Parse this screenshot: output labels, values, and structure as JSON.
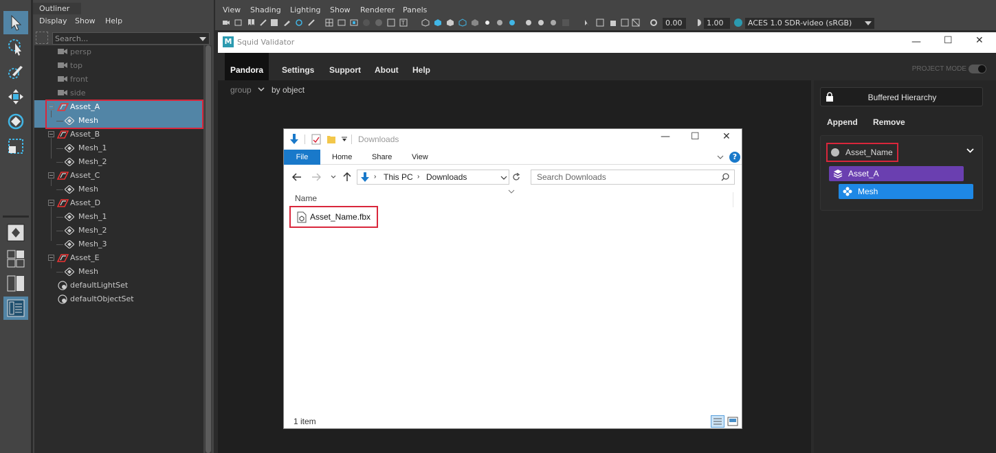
{
  "outliner": {
    "tab": "Outliner",
    "menu": [
      "Display",
      "Show",
      "Help"
    ],
    "search_placeholder": "Search...",
    "items": [
      {
        "label": "persp",
        "type": "camera",
        "dim": true
      },
      {
        "label": "top",
        "type": "camera",
        "dim": true
      },
      {
        "label": "front",
        "type": "camera",
        "dim": true
      },
      {
        "label": "side",
        "type": "camera",
        "dim": true
      },
      {
        "label": "Asset_A",
        "type": "group",
        "selected": true
      },
      {
        "label": "Mesh",
        "type": "mesh",
        "selected": true
      },
      {
        "label": "Asset_B",
        "type": "group"
      },
      {
        "label": "Mesh_1",
        "type": "mesh"
      },
      {
        "label": "Mesh_2",
        "type": "mesh"
      },
      {
        "label": "Asset_C",
        "type": "group"
      },
      {
        "label": "Mesh",
        "type": "mesh"
      },
      {
        "label": "Asset_D",
        "type": "group"
      },
      {
        "label": "Mesh_1",
        "type": "mesh"
      },
      {
        "label": "Mesh_2",
        "type": "mesh"
      },
      {
        "label": "Mesh_3",
        "type": "mesh"
      },
      {
        "label": "Asset_E",
        "type": "group"
      },
      {
        "label": "Mesh",
        "type": "mesh"
      },
      {
        "label": "defaultLightSet",
        "type": "set"
      },
      {
        "label": "defaultObjectSet",
        "type": "set"
      }
    ]
  },
  "viewport": {
    "menu": [
      "View",
      "Shading",
      "Lighting",
      "Show",
      "Renderer",
      "Panels"
    ],
    "exposure": "0.00",
    "gamma": "1.00",
    "color_space": "ACES 1.0 SDR-video (sRGB)"
  },
  "validator": {
    "title": "Squid Validator",
    "logo": "M",
    "nav": [
      "Pandora",
      "Settings",
      "Support",
      "About",
      "Help"
    ],
    "project_mode": "PROJECT MODE",
    "group_label": "group",
    "group_value": "by object",
    "buffered_hierarchy": "Buffered Hierarchy",
    "append": "Append",
    "remove": "Remove",
    "asset_name": "Asset_Name",
    "chip_asset": "Asset_A",
    "chip_mesh": "Mesh",
    "colors": {
      "purple": "#6a3fb0",
      "blue": "#1e88e5",
      "highlight": "#d9263b"
    }
  },
  "explorer": {
    "title": "Downloads",
    "tabs": [
      "File",
      "Home",
      "Share",
      "View"
    ],
    "path": [
      "This PC",
      "Downloads"
    ],
    "search_placeholder": "Search Downloads",
    "column": "Name",
    "file": "Asset_Name.fbx",
    "status": "1 item"
  }
}
